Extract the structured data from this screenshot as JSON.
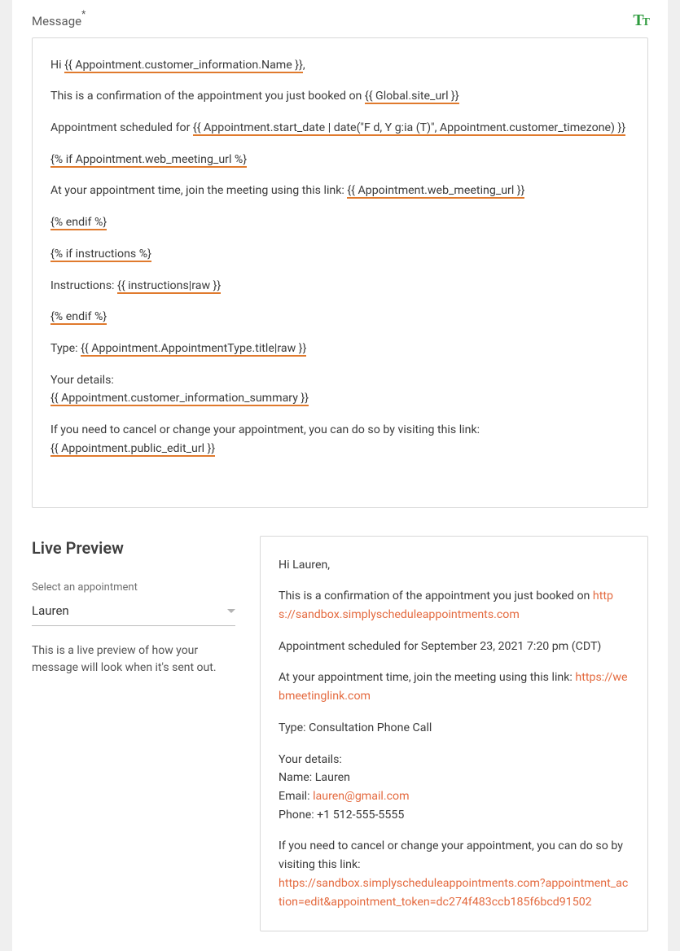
{
  "field": {
    "label": "Message",
    "required_marker": "*"
  },
  "template": {
    "l1a": "Hi ",
    "t1": "{{ Appointment.customer_information.Name }}",
    "l1b": ",",
    "l2a": "This is a confirmation of the appointment you just booked on ",
    "t2": "{{ Global.site_url }}",
    "l3a": "Appointment scheduled for ",
    "t3": "{{ Appointment.start_date | date(\"F d, Y g:ia (T)\", Appointment.customer_timezone) }}",
    "t4": "{% if Appointment.web_meeting_url %}",
    "l5a": "At your appointment time, join the meeting using this link: ",
    "t5": "{{ Appointment.web_meeting_url }}",
    "t6": "{% endif %}",
    "t7": "{% if instructions %}",
    "l8a": "Instructions: ",
    "t8": "{{ instructions|raw }}",
    "t9": "{% endif %}",
    "l10a": "Type: ",
    "t10": "{{ Appointment.AppointmentType.title|raw }}",
    "l11a": "Your details:",
    "t11": "{{ Appointment.customer_information_summary }}",
    "l12a": "If you need to cancel or change your appointment, you can do so by visiting this link:",
    "t12": "{{ Appointment.public_edit_url }}"
  },
  "live_preview": {
    "title": "Live Preview",
    "select_label": "Select an appointment",
    "selected": "Lauren",
    "help": "This is a live preview of how your message will look when it's sent out."
  },
  "preview": {
    "greeting": "Hi Lauren,",
    "p2a": "This is a confirmation of the appointment you just booked on ",
    "p2_link": "https://sandbox.simplyscheduleappointments.com",
    "p3": "Appointment scheduled for September 23, 2021 7:20 pm (CDT)",
    "p4a": "At your appointment time, join the meeting using this link: ",
    "p4_link": "https://webmeetinglink.com",
    "p5": "Type: Consultation Phone Call",
    "p6_l1": "Your details:",
    "p6_l2": "Name: Lauren",
    "p6_email_label": "Email: ",
    "p6_email_link": "lauren@gmail.com",
    "p6_l4": "Phone: +1 512-555-5555",
    "p7a": "If you need to cancel or change your appointment, you can do so by visiting this link:",
    "p7_link": "https://sandbox.simplyscheduleappointments.com?appointment_action=edit&appointment_token=dc274f483ccb185f6bcd91502"
  }
}
